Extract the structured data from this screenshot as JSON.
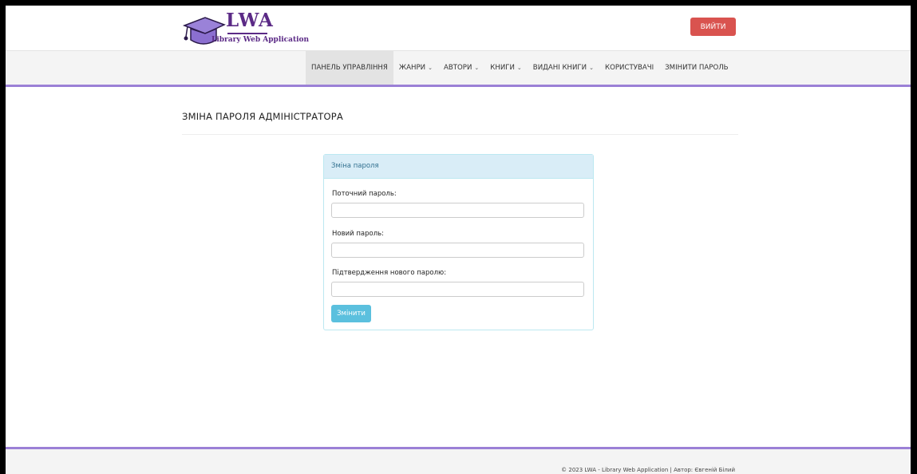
{
  "header": {
    "logo": {
      "title": "LWA",
      "subtitle": "Library Web Application",
      "icon": "graduation-cap-icon"
    },
    "logout_label": "ВИЙТИ",
    "colors": {
      "brand": "#5b2a86",
      "logout": "#d9534f",
      "accent_line": "#9b80d6"
    }
  },
  "nav": {
    "items": [
      {
        "label": "ПАНЕЛЬ УПРАВЛІННЯ",
        "active": true,
        "dropdown": false
      },
      {
        "label": "ЖАНРИ",
        "dropdown": true
      },
      {
        "label": "АВТОРИ",
        "dropdown": true
      },
      {
        "label": "КНИГИ",
        "dropdown": true
      },
      {
        "label": "ВИДАНІ КНИГИ",
        "dropdown": true
      },
      {
        "label": "КОРИСТУВАЧІ",
        "dropdown": false
      },
      {
        "label": "ЗМІНИТИ ПАРОЛЬ",
        "dropdown": false
      }
    ]
  },
  "main": {
    "title": "ЗМІНА ПАРОЛЯ АДМІНІСТРАТОРА",
    "panel": {
      "heading": "Зміна пароля",
      "fields": [
        {
          "label": "Поточний пароль:",
          "value": ""
        },
        {
          "label": "Новий пароль:",
          "value": ""
        },
        {
          "label": "Підтвердження нового паролю:",
          "value": ""
        }
      ],
      "submit_label": "Змінити",
      "colors": {
        "heading_bg": "#d9edf7",
        "submit_bg": "#5bc0de"
      }
    }
  },
  "footer": {
    "copyright": "© 2023 LWA - Library Web Application | Автор: Євгеній Білий"
  }
}
